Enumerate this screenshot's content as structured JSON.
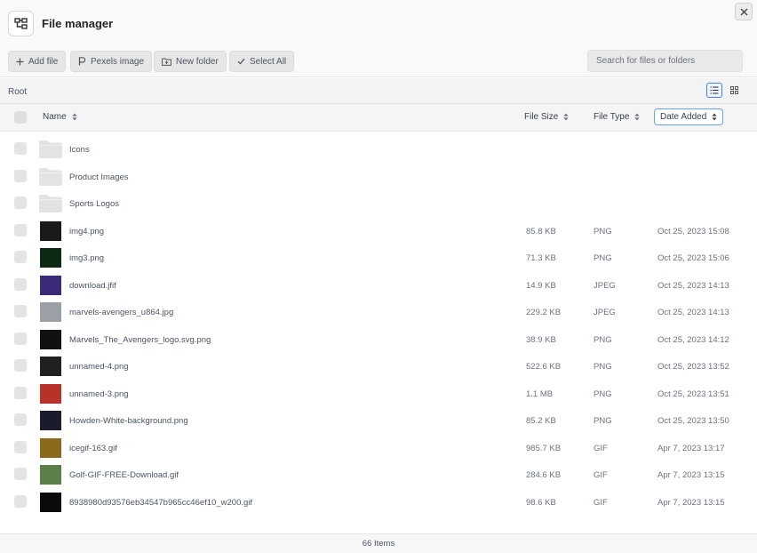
{
  "app": {
    "title": "File manager"
  },
  "toolbar": {
    "add_file": "Add file",
    "pexels_image": "Pexels image",
    "new_folder": "New folder",
    "select_all": "Select All",
    "search_placeholder": "Search for files or folders"
  },
  "breadcrumb": {
    "root": "Root"
  },
  "columns": {
    "name": "Name",
    "size": "File Size",
    "type": "File Type",
    "date": "Date Added"
  },
  "sort": {
    "active_column": "Date Added"
  },
  "rows": [
    {
      "kind": "folder",
      "name": "Icons",
      "size": "",
      "type": "",
      "date": ""
    },
    {
      "kind": "folder",
      "name": "Product Images",
      "size": "",
      "type": "",
      "date": ""
    },
    {
      "kind": "folder",
      "name": "Sports Logos",
      "size": "",
      "type": "",
      "date": ""
    },
    {
      "kind": "image",
      "thumb": "#1a1a1a",
      "name": "img4.png",
      "size": "85.8 KB",
      "type": "PNG",
      "date": "Oct 25, 2023 15:08"
    },
    {
      "kind": "image",
      "thumb": "#0f2a14",
      "name": "img3.png",
      "size": "71.3 KB",
      "type": "PNG",
      "date": "Oct 25, 2023 15:06"
    },
    {
      "kind": "image",
      "thumb": "#3b2a7a",
      "name": "download.jfif",
      "size": "14.9 KB",
      "type": "JPEG",
      "date": "Oct 25, 2023 14:13"
    },
    {
      "kind": "image",
      "thumb": "#9aa0a6",
      "name": "marvels-avengers_u864.jpg",
      "size": "229.2 KB",
      "type": "JPEG",
      "date": "Oct 25, 2023 14:13"
    },
    {
      "kind": "image",
      "thumb": "#111111",
      "name": "Marvels_The_Avengers_logo.svg.png",
      "size": "38.9 KB",
      "type": "PNG",
      "date": "Oct 25, 2023 14:12"
    },
    {
      "kind": "image",
      "thumb": "#202020",
      "name": "unnamed-4.png",
      "size": "522.6 KB",
      "type": "PNG",
      "date": "Oct 25, 2023 13:52"
    },
    {
      "kind": "image",
      "thumb": "#b8322a",
      "name": "unnamed-3.png",
      "size": "1.1 MB",
      "type": "PNG",
      "date": "Oct 25, 2023 13:51"
    },
    {
      "kind": "image",
      "thumb": "#1b1b2e",
      "name": "Howden-White-background.png",
      "size": "85.2 KB",
      "type": "PNG",
      "date": "Oct 25, 2023 13:50"
    },
    {
      "kind": "image",
      "thumb": "#8a6a1a",
      "name": "icegif-163.gif",
      "size": "985.7 KB",
      "type": "GIF",
      "date": "Apr 7, 2023 13:17"
    },
    {
      "kind": "image",
      "thumb": "#5c7f4a",
      "name": "Golf-GIF-FREE-Download.gif",
      "size": "284.6 KB",
      "type": "GIF",
      "date": "Apr 7, 2023 13:15"
    },
    {
      "kind": "image",
      "thumb": "#0a0a0a",
      "name": "8938980d93576eb34547b965cc46ef10_w200.gif",
      "size": "98.6 KB",
      "type": "GIF",
      "date": "Apr 7, 2023 13:15"
    }
  ],
  "footer": {
    "count": "66 Items"
  },
  "colors": {
    "accent": "#3b82f6",
    "folder": "#e3e3e3"
  }
}
